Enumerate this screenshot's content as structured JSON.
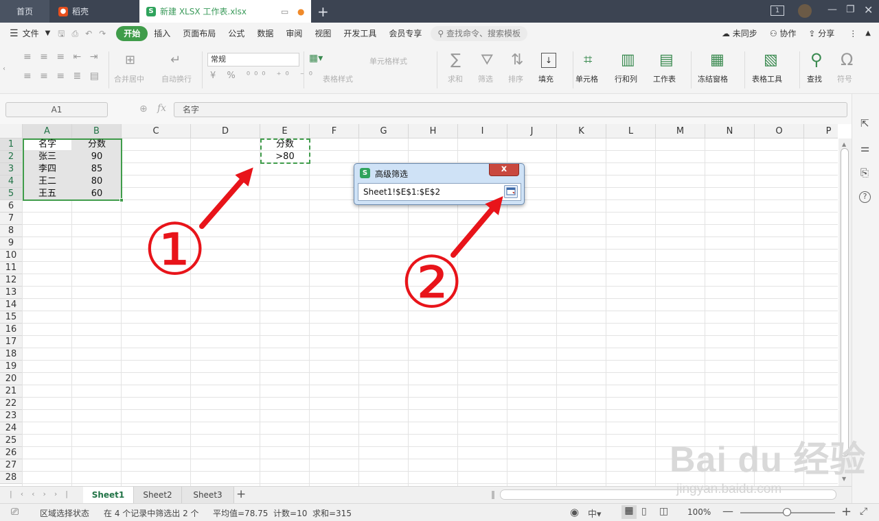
{
  "tabs": {
    "home": "首页",
    "daoke": "稻壳",
    "file": "新建 XLSX 工作表.xlsx",
    "add": "+"
  },
  "menu": {
    "file": "文件",
    "items": [
      "开始",
      "插入",
      "页面布局",
      "公式",
      "数据",
      "审阅",
      "视图",
      "开发工具",
      "会员专享"
    ],
    "search_placeholder": "查找命令、搜索模板",
    "right": [
      "未同步",
      "协作",
      "分享"
    ]
  },
  "ribbon": {
    "merge": "合并居中",
    "wrap": "自动换行",
    "number_format": "常规",
    "cond_format": "单元格样式",
    "table_style": "表格样式",
    "sum": "求和",
    "filter": "筛选",
    "sort": "排序",
    "fill": "填充",
    "cell": "单元格",
    "rowcol": "行和列",
    "worksheet": "工作表",
    "freeze": "冻结窗格",
    "table_tools": "表格工具",
    "find": "查找",
    "symbol": "符号"
  },
  "formula_bar": {
    "name_box": "A1",
    "fx": "fx",
    "value": "名字"
  },
  "columns": [
    "A",
    "B",
    "C",
    "D",
    "E",
    "F",
    "G",
    "H",
    "I",
    "J",
    "K",
    "L",
    "M",
    "N",
    "O",
    "P"
  ],
  "rows": [
    "1",
    "2",
    "3",
    "4",
    "5",
    "6",
    "7",
    "8",
    "9",
    "10",
    "11",
    "12",
    "13",
    "14",
    "15",
    "16",
    "17",
    "18",
    "19",
    "20",
    "21",
    "22",
    "23",
    "24",
    "25",
    "26",
    "27",
    "28"
  ],
  "cells": {
    "A1": "名字",
    "B1": "分数",
    "A2": "张三",
    "B2": "90",
    "A3": "李四",
    "B3": "85",
    "A4": "王二",
    "B4": "80",
    "A5": "王五",
    "B5": "60",
    "E1": "分数",
    "E2": ">80"
  },
  "dialog": {
    "title": "高级筛选",
    "range": "Sheet1!$E$1:$E$2",
    "close": "x"
  },
  "annotations": {
    "callout1": "①",
    "callout2": "②"
  },
  "sheet_tabs": [
    "Sheet1",
    "Sheet2",
    "Sheet3"
  ],
  "status": {
    "mode": "区域选择状态",
    "filter_info": "在 4 个记录中筛选出 2 个",
    "stats": "平均值=78.75  计数=10  求和=315",
    "zoom": "100%"
  },
  "watermark": {
    "logo": "Bai du 经验",
    "url": "jingyan.baidu.com"
  },
  "colors": {
    "accent": "#3f9c4a",
    "callout_red": "#e8141a",
    "selection_green": "#217346"
  }
}
